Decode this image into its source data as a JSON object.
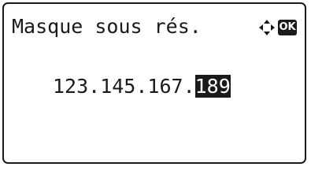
{
  "screen": {
    "title": "Masque sous rés.",
    "ok_label": "OK",
    "nav_icon": "dpad-arrows-icon"
  },
  "address": {
    "fixed": "123.145.167.",
    "selected": "189"
  },
  "colors": {
    "foreground": "#1a1a1a",
    "background": "#ffffff"
  }
}
